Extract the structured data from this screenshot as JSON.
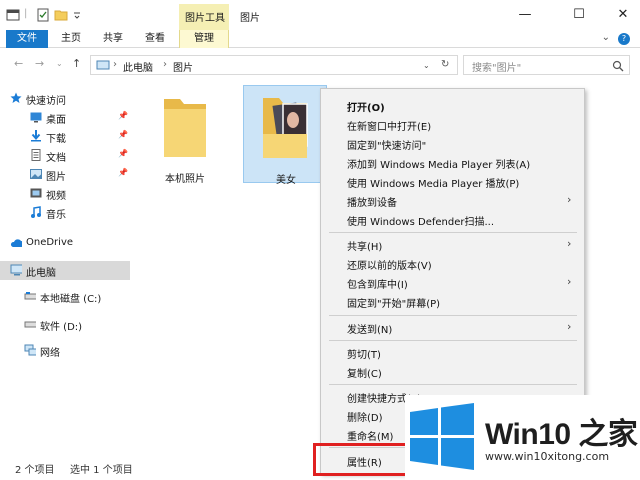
{
  "window": {
    "title": "图片",
    "contextual_tab_group": "图片工具",
    "controls": [
      "—",
      "☐",
      "✕"
    ]
  },
  "ribbon": {
    "tabs": [
      "文件",
      "主页",
      "共享",
      "查看",
      "管理"
    ]
  },
  "address": {
    "crumbs": [
      "此电脑",
      "图片"
    ],
    "search_placeholder": "搜索\"图片\""
  },
  "sidebar": {
    "items": [
      {
        "label": "快速访问",
        "icon": "star-icon",
        "pinned": false
      },
      {
        "label": "桌面",
        "icon": "desktop-icon",
        "pinned": true
      },
      {
        "label": "下载",
        "icon": "download-icon",
        "pinned": true
      },
      {
        "label": "文档",
        "icon": "document-icon",
        "pinned": true
      },
      {
        "label": "图片",
        "icon": "picture-icon",
        "pinned": true
      },
      {
        "label": "视频",
        "icon": "video-icon",
        "pinned": false
      },
      {
        "label": "音乐",
        "icon": "music-icon",
        "pinned": false
      },
      {
        "label": "OneDrive",
        "icon": "cloud-icon",
        "pinned": false
      },
      {
        "label": "此电脑",
        "icon": "computer-icon",
        "pinned": false,
        "selected": true
      },
      {
        "label": "本地磁盘 (C:)",
        "icon": "drive-icon",
        "pinned": false
      },
      {
        "label": "软件 (D:)",
        "icon": "drive-icon",
        "pinned": false
      },
      {
        "label": "网络",
        "icon": "network-icon",
        "pinned": false
      }
    ]
  },
  "files": [
    {
      "name": "本机照片",
      "selected": false
    },
    {
      "name": "美女",
      "selected": true
    }
  ],
  "status": {
    "count": "2 个项目",
    "selection": "选中 1 个项目"
  },
  "context_menu": {
    "groups": [
      [
        {
          "label": "打开(O)",
          "bold": true
        },
        {
          "label": "在新窗口中打开(E)"
        },
        {
          "label": "固定到\"快速访问\""
        },
        {
          "label": "添加到 Windows Media Player 列表(A)"
        },
        {
          "label": "使用 Windows Media Player 播放(P)"
        },
        {
          "label": "播放到设备",
          "submenu": true
        },
        {
          "label": "使用 Windows Defender扫描..."
        }
      ],
      [
        {
          "label": "共享(H)",
          "submenu": true
        },
        {
          "label": "还原以前的版本(V)"
        },
        {
          "label": "包含到库中(I)",
          "submenu": true
        },
        {
          "label": "固定到\"开始\"屏幕(P)"
        }
      ],
      [
        {
          "label": "发送到(N)",
          "submenu": true
        }
      ],
      [
        {
          "label": "剪切(T)"
        },
        {
          "label": "复制(C)"
        }
      ],
      [
        {
          "label": "创建快捷方式(S)"
        },
        {
          "label": "删除(D)"
        },
        {
          "label": "重命名(M)"
        }
      ],
      [
        {
          "label": "属性(R)"
        }
      ]
    ]
  },
  "watermark": {
    "brand": "Win10 之家",
    "url": "www.win10xitong.com"
  },
  "colors": {
    "accent": "#1979ca",
    "selection": "#cce4f7",
    "highlight_box": "#e02020",
    "logo_blue": "#1e8ee0"
  }
}
